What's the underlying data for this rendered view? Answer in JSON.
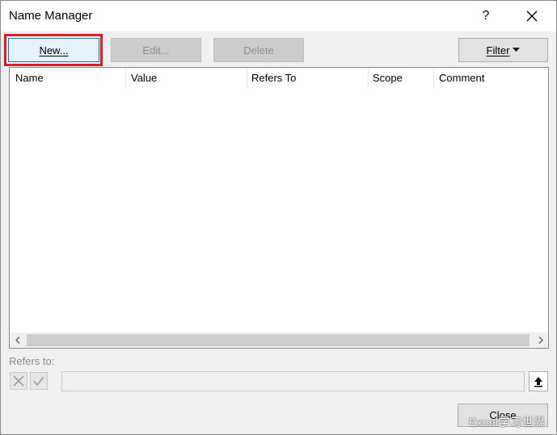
{
  "window": {
    "title": "Name Manager",
    "help_label": "?"
  },
  "toolbar": {
    "new_label": "New...",
    "edit_label": "Edit...",
    "delete_label": "Delete",
    "filter_label": "Filter"
  },
  "list": {
    "columns": [
      "Name",
      "Value",
      "Refers To",
      "Scope",
      "Comment"
    ]
  },
  "refers": {
    "label": "Refers to:",
    "value": ""
  },
  "footer": {
    "close_label": "Close"
  },
  "watermark": "Excel学习世界",
  "colors": {
    "highlight": "#e01b24",
    "focus_border": "#0078d7"
  },
  "icons": [
    "close-icon",
    "cancel-x-icon",
    "confirm-check-icon",
    "collapse-dialog-icon",
    "dropdown-arrow-icon",
    "scroll-left-icon",
    "scroll-right-icon"
  ]
}
